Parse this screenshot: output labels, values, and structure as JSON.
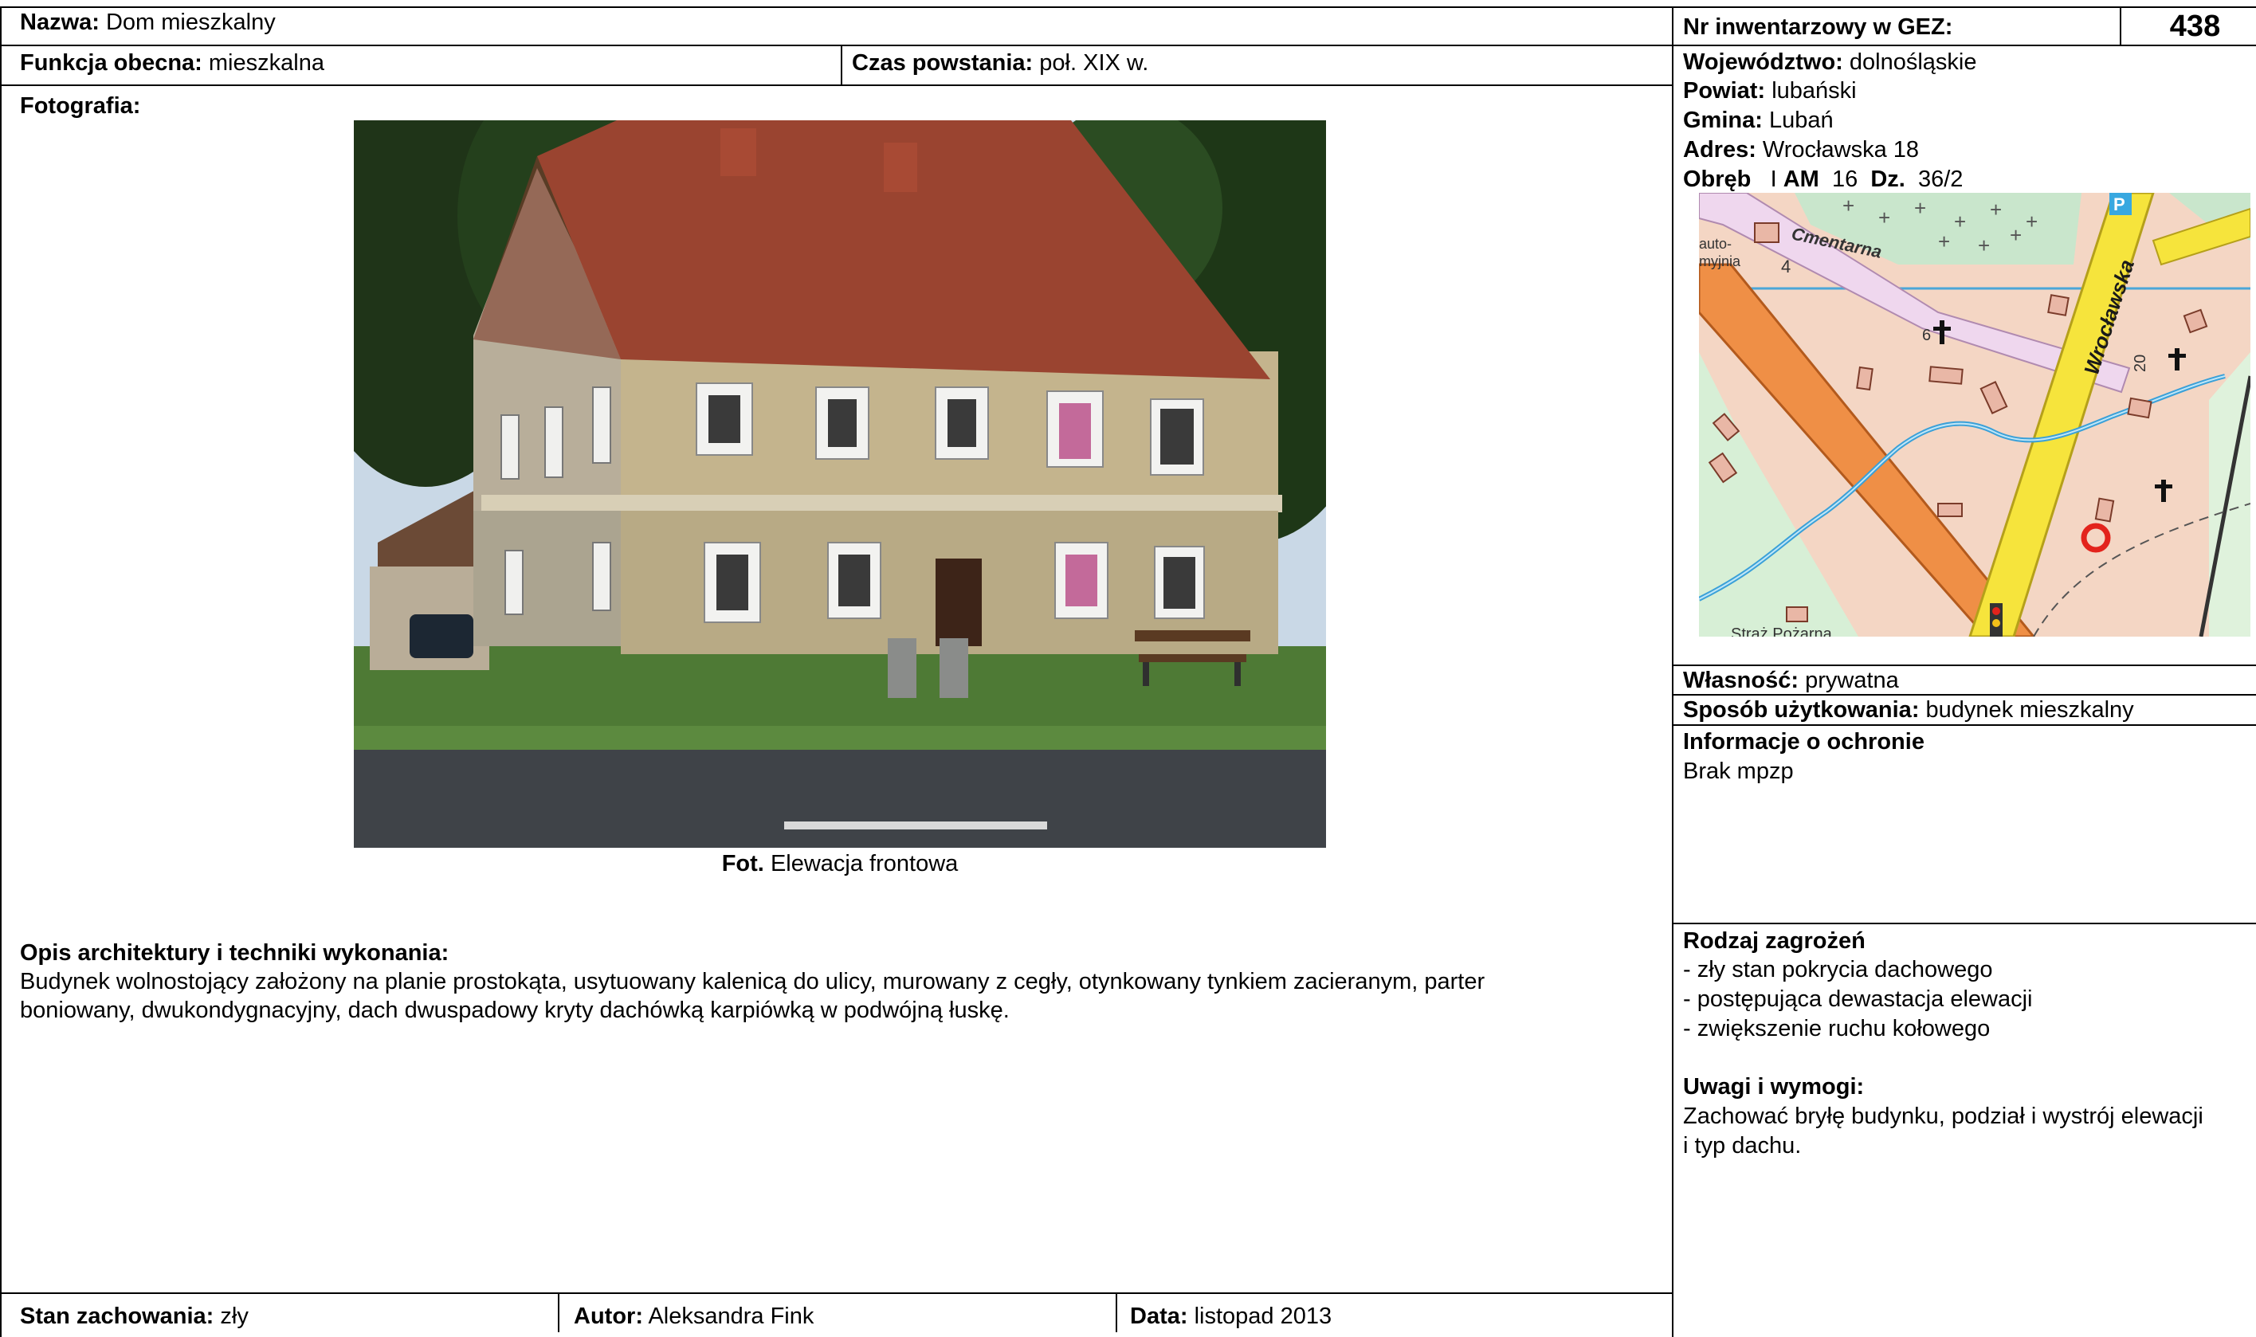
{
  "left": {
    "name": {
      "label": "Nazwa:",
      "value": "Dom mieszkalny"
    },
    "function": {
      "label": "Funkcja obecna:",
      "value": "mieszkalna"
    },
    "date_built": {
      "label": "Czas powstania:",
      "value": "poł. XIX w."
    },
    "photo": {
      "label": "Fotografia:",
      "caption_bold": "Fot.",
      "caption": "Elewacja frontowa"
    },
    "description": {
      "label": "Opis architektury i techniki wykonania:",
      "line1": "Budynek wolnostojący założony na planie prostokąta, usytuowany kalenicą do ulicy, murowany z cegły, otynkowany tynkiem zacieranym, parter",
      "line2": "boniowany, dwukondygnacyjny, dach dwuspadowy kryty dachówką karpiówką w podwójną łuskę."
    },
    "condition": {
      "label": "Stan zachowania:",
      "value": "zły"
    },
    "author": {
      "label": "Autor:",
      "value": "Aleksandra Fink"
    },
    "date": {
      "label": "Data:",
      "value": "listopad 2013"
    }
  },
  "right": {
    "inventory": {
      "label": "Nr inwentarzowy w GEZ:",
      "value": "438"
    },
    "voivodeship": {
      "label": "Województwo:",
      "value": "dolnośląskie"
    },
    "county": {
      "label": "Powiat:",
      "value": "lubański"
    },
    "commune": {
      "label": "Gmina:",
      "value": "Lubań"
    },
    "address": {
      "label": "Adres:",
      "value": "Wrocławska 18"
    },
    "parcel": {
      "obreb_label": "Obręb",
      "obreb": "I",
      "am_label": "AM",
      "am": "16",
      "dz_label": "Dz.",
      "dz": "36/2"
    },
    "map": {
      "street_main": "Wrocławska",
      "street_cemetery": "Cmentarna",
      "poi_carwash_1": "auto-",
      "poi_carwash_2": "myjnia",
      "num_4": "4",
      "num_6": "6",
      "num_20": "20",
      "poi_firestation": "Straż Pożarna",
      "parking": "P"
    },
    "ownership": {
      "label": "Własność:",
      "value": "prywatna"
    },
    "usage": {
      "label": "Sposób użytkowania:",
      "value": "budynek mieszkalny"
    },
    "protection": {
      "label": "Informacje o ochronie",
      "value": "Brak mpzp"
    },
    "threats": {
      "label": "Rodzaj zagrożeń",
      "items": [
        "- zły stan pokrycia dachowego",
        "- postępująca dewastacja elewacji",
        "- zwiększenie ruchu kołowego"
      ]
    },
    "remarks": {
      "label": "Uwagi i wymogi:",
      "line1": "Zachować bryłę budynku, podział i wystrój elewacji",
      "line2": "i typ dachu."
    }
  }
}
